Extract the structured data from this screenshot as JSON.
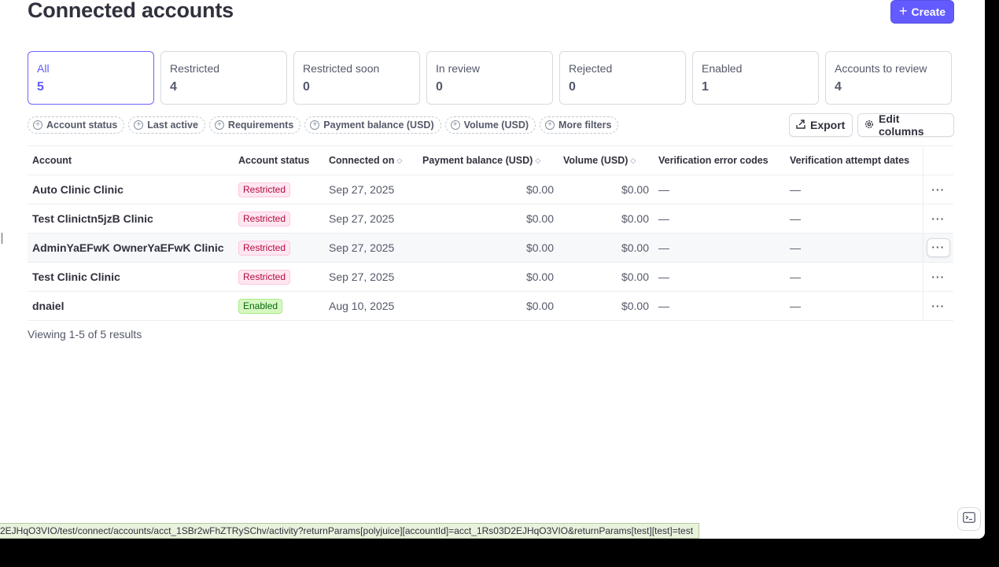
{
  "header": {
    "title": "Connected accounts",
    "create_label": "Create"
  },
  "status_cards": [
    {
      "label": "All",
      "count": "5"
    },
    {
      "label": "Restricted",
      "count": "4"
    },
    {
      "label": "Restricted soon",
      "count": "0"
    },
    {
      "label": "In review",
      "count": "0"
    },
    {
      "label": "Rejected",
      "count": "0"
    },
    {
      "label": "Enabled",
      "count": "1"
    },
    {
      "label": "Accounts to review",
      "count": "4"
    }
  ],
  "filters": [
    "Account status",
    "Last active",
    "Requirements",
    "Payment balance (USD)",
    "Volume (USD)",
    "More filters"
  ],
  "toolbar": {
    "export_label": "Export",
    "edit_columns_label": "Edit columns"
  },
  "table": {
    "columns": [
      "Account",
      "Account status",
      "Connected on",
      "Payment balance (USD)",
      "Volume (USD)",
      "Verification error codes",
      "Verification attempt dates"
    ],
    "rows": [
      {
        "account": "Auto Clinic Clinic",
        "status": "Restricted",
        "connected_on": "Sep 27, 2025",
        "balance": "$0.00",
        "volume": "$0.00",
        "error_codes": "—",
        "attempt_dates": "—"
      },
      {
        "account": "Test Clinictn5jzB Clinic",
        "status": "Restricted",
        "connected_on": "Sep 27, 2025",
        "balance": "$0.00",
        "volume": "$0.00",
        "error_codes": "—",
        "attempt_dates": "—"
      },
      {
        "account": "AdminYaEFwK OwnerYaEFwK Clinic",
        "status": "Restricted",
        "connected_on": "Sep 27, 2025",
        "balance": "$0.00",
        "volume": "$0.00",
        "error_codes": "—",
        "attempt_dates": "—"
      },
      {
        "account": "Test Clinic Clinic",
        "status": "Restricted",
        "connected_on": "Sep 27, 2025",
        "balance": "$0.00",
        "volume": "$0.00",
        "error_codes": "—",
        "attempt_dates": "—"
      },
      {
        "account": "dnaiel",
        "status": "Enabled",
        "connected_on": "Aug 10, 2025",
        "balance": "$0.00",
        "volume": "$0.00",
        "error_codes": "—",
        "attempt_dates": "—"
      }
    ]
  },
  "footer": {
    "viewing_text": "Viewing 1-5 of 5 results"
  },
  "status_bar": {
    "url": "2EJHqO3VIO/test/connect/accounts/acct_1SBr2wFhZTRySChv/activity?returnParams[polyjuice][accountId]=acct_1Rs03D2EJHqO3VIO&returnParams[test][test]=test"
  },
  "colors": {
    "accent": "#635bff",
    "restricted": "#b3093c",
    "enabled": "#05690d"
  }
}
